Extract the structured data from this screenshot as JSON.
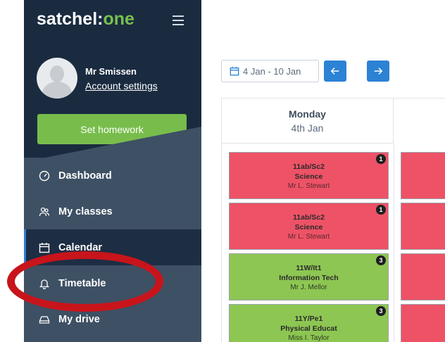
{
  "sidebar": {
    "logo_main": "satchel:",
    "logo_accent": "one",
    "user_name": "Mr Smissen",
    "account_link": "Account settings",
    "set_homework": "Set homework",
    "items": [
      {
        "label": "Dashboard",
        "icon": "dashboard-icon"
      },
      {
        "label": "My classes",
        "icon": "classes-icon"
      },
      {
        "label": "Calendar",
        "icon": "calendar-icon",
        "active": true
      },
      {
        "label": "Timetable",
        "icon": "bell-icon"
      },
      {
        "label": "My drive",
        "icon": "drive-icon"
      }
    ]
  },
  "toolbar": {
    "date_range": "4 Jan - 10 Jan"
  },
  "calendar": {
    "column": {
      "day": "Monday",
      "date": "4th Jan"
    },
    "lessons": [
      {
        "code": "11ab/Sc2",
        "subject": "Science",
        "teacher": "Mr L. Stewart",
        "badge": "1",
        "color": "#ee5266"
      },
      {
        "code": "11ab/Sc2",
        "subject": "Science",
        "teacher": "Mr L. Stewart",
        "badge": "1",
        "color": "#ee5266"
      },
      {
        "code": "11W/It1",
        "subject": "Information Tech",
        "teacher": "Mr J. Mellor",
        "badge": "3",
        "color": "#8dc653"
      },
      {
        "code": "11Y/Pe1",
        "subject": "Physical Educat",
        "teacher": "Miss I. Taylor",
        "badge": "3",
        "color": "#8dc653"
      }
    ]
  },
  "colors": {
    "sidebar_dark": "#1a2b40",
    "sidebar": "#3e5064",
    "accent_green": "#78bd4c",
    "primary_blue": "#2c82d4",
    "annotation_red": "#c8141b"
  }
}
